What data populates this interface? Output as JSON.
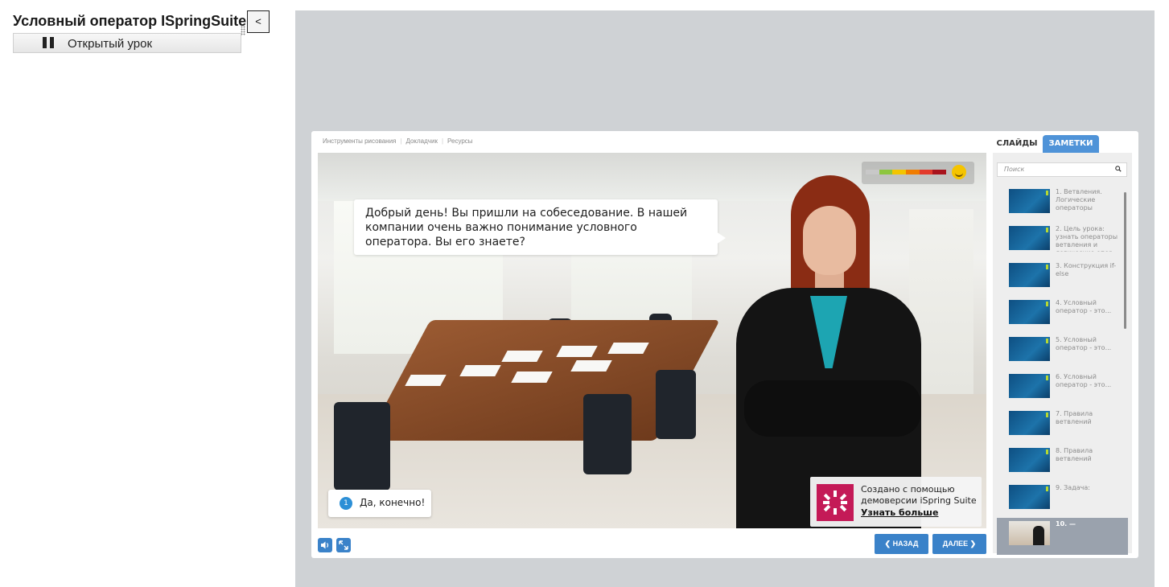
{
  "page": {
    "lesson_title": "Условный оператор ISpringSuite",
    "collapse_label": "<",
    "lesson_item_label": "Открытый урок"
  },
  "player": {
    "top_nav": [
      "Инструменты рисования",
      "Докладчик",
      "Ресурсы"
    ],
    "speech": "Добрый день! Вы пришли на собеседование. В нашей компании очень важно понимание условного оператора. Вы его знаете?",
    "answers": [
      {
        "number": "1",
        "text": "Да, конечно!"
      }
    ],
    "mood_colors": [
      "#c8c8c8",
      "#8dc63f",
      "#f2c500",
      "#f07d00",
      "#e23a2b",
      "#a8141d"
    ],
    "promo": {
      "line1": "Создано с помощью",
      "line2": "демоверсии iSpring Suite",
      "link": "Узнать больше",
      "color": "#c41a57"
    },
    "controls": {
      "volume_icon": "volume-icon",
      "fullscreen_icon": "fullscreen-icon"
    },
    "nav": {
      "back": "❮ НАЗАД",
      "next": "ДАЛЕЕ ❯",
      "accent": "#3a82c9"
    }
  },
  "sidebar": {
    "tab_slides": "СЛАЙДЫ",
    "tab_notes": "ЗАМЕТКИ",
    "search_placeholder": "Поиск",
    "slides": [
      "1. Ветвления. Логические операторы",
      "2. Цель урока: узнать операторы ветвления и логические опер...",
      "3. Конструкция if-else",
      "4. Условный оператор - это...",
      "5. Условный оператор - это...",
      "6. Условный оператор - это...",
      "7. Правила ветвлений",
      "8. Правила ветвлений",
      "9. Задача:",
      "10. —"
    ],
    "active_slide": 10
  }
}
